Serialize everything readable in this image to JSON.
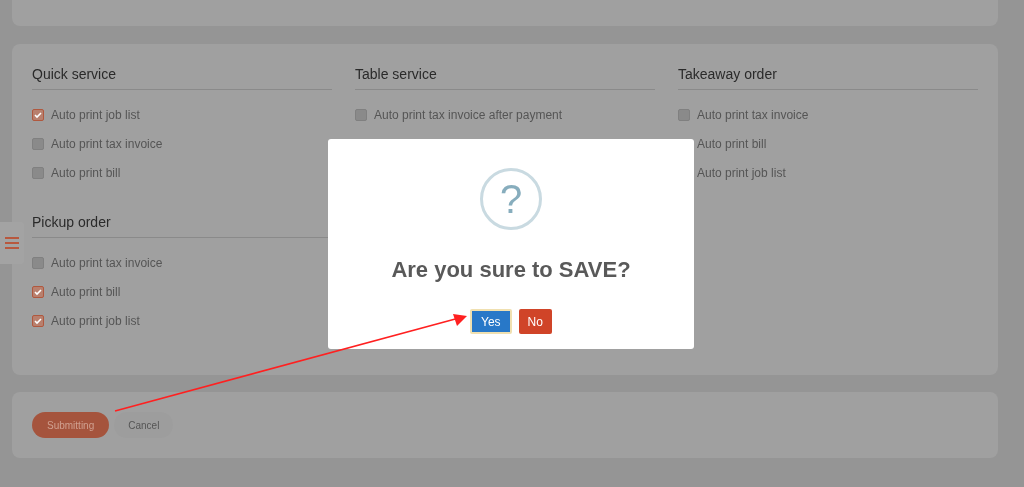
{
  "sections": [
    {
      "title": "Quick service",
      "options": [
        {
          "label": "Auto print job list",
          "checked": true
        },
        {
          "label": "Auto print tax invoice",
          "checked": false
        },
        {
          "label": "Auto print bill",
          "checked": false
        }
      ]
    },
    {
      "title": "Table service",
      "options": [
        {
          "label": "Auto print tax invoice after payment",
          "checked": false
        }
      ]
    },
    {
      "title": "Takeaway order",
      "options": [
        {
          "label": "Auto print tax invoice",
          "checked": false
        },
        {
          "label": "Auto print bill"
        },
        {
          "label": "Auto print job list"
        }
      ]
    },
    {
      "title": "Pickup order",
      "options": [
        {
          "label": "Auto print tax invoice",
          "checked": false
        },
        {
          "label": "Auto print bill",
          "checked": true
        },
        {
          "label": "Auto print job list",
          "checked": true
        }
      ]
    }
  ],
  "actions": [
    {
      "label": "Submitting",
      "kind": "primary"
    },
    {
      "label": "Cancel",
      "kind": "secondary"
    }
  ],
  "dialog": {
    "icon": "?",
    "title": "Are you sure to SAVE?",
    "buttons": [
      {
        "label": "Yes",
        "kind": "confirm"
      },
      {
        "label": "No",
        "kind": "cancel"
      }
    ]
  }
}
